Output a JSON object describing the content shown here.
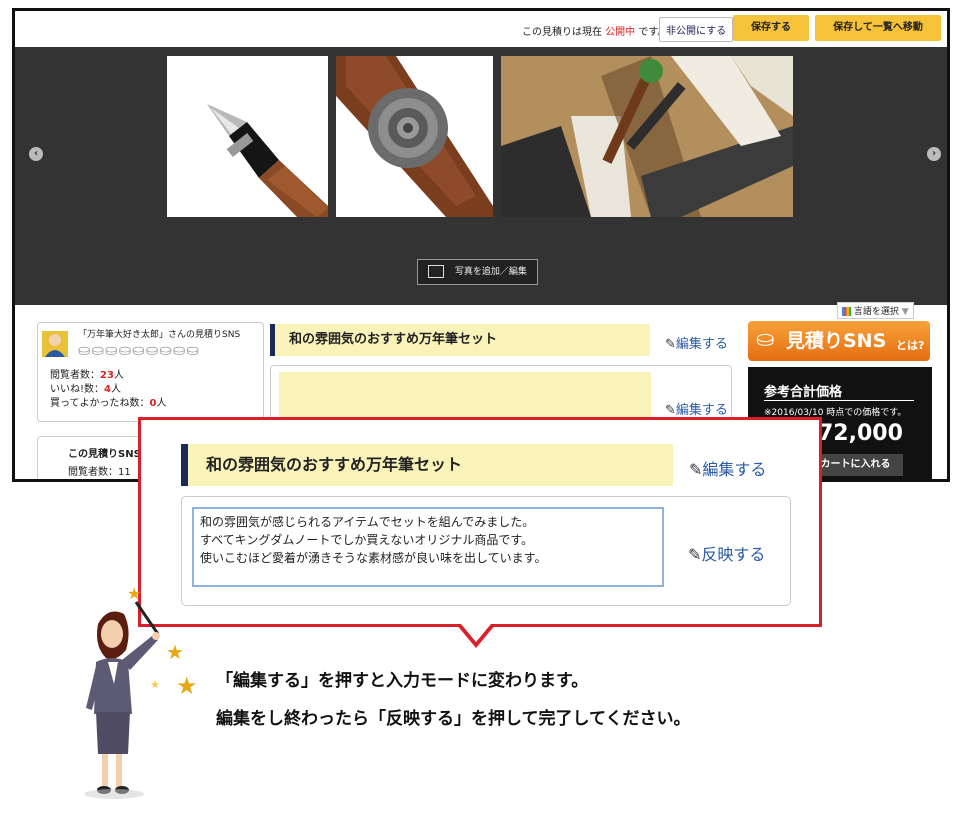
{
  "topbar": {
    "status_prefix": "この見積りは現在",
    "status_value": "公開中",
    "status_suffix": "です。",
    "private_button": "非公開にする",
    "save_button": "保存する",
    "save_list_button": "保存して一覧へ移動"
  },
  "gallery": {
    "add_photo_button": "写真を追加／編集",
    "prev_arrow": "‹",
    "next_arrow": "›"
  },
  "language": {
    "label": "言語を選択",
    "dropdown": "▼"
  },
  "profile": {
    "name": "「万年筆大好き太郎」さんの見積りSNS",
    "views_label": "閲覧者数：",
    "views_value": "23",
    "views_unit": "人",
    "likes_label": "いいね!数：",
    "likes_value": "4",
    "likes_unit": "人",
    "bought_label": "買ってよかったね数：",
    "bought_value": "0",
    "bought_unit": "人"
  },
  "profile2": {
    "title": "この見積りSNS",
    "views_partial": "閲覧者数：11"
  },
  "estimate": {
    "title": "和の雰囲気のおすすめ万年筆セット",
    "edit_label": "編集する",
    "edit_label_2": "編集する"
  },
  "sns_logo": {
    "text": "見積りSNS",
    "suffix": "とは?"
  },
  "price": {
    "heading": "参考合計価格",
    "note": "※2016/03/10 時点での価格です。",
    "amount": "72,000",
    "cart_button": "カートに入れる"
  },
  "callout": {
    "title": "和の雰囲気のおすすめ万年筆セット",
    "edit_label": "編集する",
    "description_lines": [
      "和の雰囲気が感じられるアイテムでセットを組んでみました。",
      "すべてキングダムノートでしか買えないオリジナル商品です。",
      "使いこむほど愛着が湧きそうな素材感が良い味を出しています。"
    ],
    "apply_label": "反映する"
  },
  "notes": {
    "line1": "「編集する」を押すと入力モードに変わります。",
    "line2": "編集をし終わったら「反映する」を押して完了してください。"
  },
  "icons": {
    "pen": "pen-edit-icon",
    "stars": "star-icon",
    "bag": "shopping-bag-icon"
  },
  "colors": {
    "accent_red": "#d9202a",
    "accent_yellow": "#f6c23a",
    "title_bg": "#f9f3b9",
    "link_blue": "#2a5aa8",
    "star_gold": "#e6a817"
  }
}
